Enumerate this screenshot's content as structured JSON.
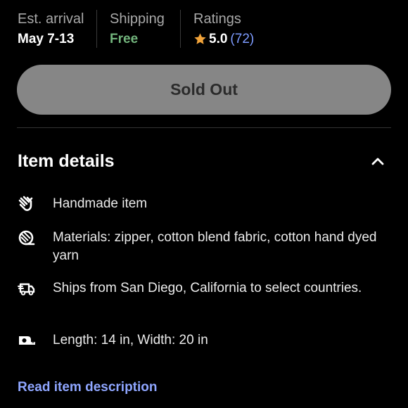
{
  "info": {
    "arrival_label": "Est. arrival",
    "arrival_value": "May 7-13",
    "shipping_label": "Shipping",
    "shipping_value": "Free",
    "ratings_label": "Ratings",
    "rating_value": "5.0",
    "rating_count": "(72)"
  },
  "colors": {
    "free": "#72b47c",
    "star": "#f1a33a",
    "link": "#8fa6ff",
    "button_bg": "#868686"
  },
  "button": {
    "label": "Sold Out"
  },
  "details": {
    "title": "Item details",
    "toggle_icon": "chevron-up-icon",
    "items": [
      {
        "icon": "hand-icon",
        "text": "Handmade item"
      },
      {
        "icon": "yarn-icon",
        "text": "Materials: zipper, cotton blend fabric, cotton hand dyed yarn"
      },
      {
        "icon": "truck-icon",
        "text": "Ships from San Diego, California to select countries."
      },
      {
        "icon": "tape-measure-icon",
        "text": "Length: 14 in, Width: 20 in"
      }
    ],
    "read_more": "Read item description"
  }
}
